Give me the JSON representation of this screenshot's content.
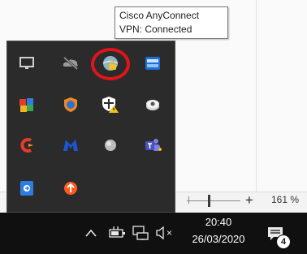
{
  "tooltip": {
    "line1": "Cisco AnyConnect",
    "line2": "VPN: Connected"
  },
  "statusbar": {
    "zoom_value": "161 %",
    "zoom_plus": "+"
  },
  "tray_icons": [
    {
      "name": "monitor-icon"
    },
    {
      "name": "onedrive-offline-icon"
    },
    {
      "name": "cisco-anyconnect-vpn-icon"
    },
    {
      "name": "keyboard-ime-icon"
    },
    {
      "name": "multicolor-app-icon"
    },
    {
      "name": "globe-shield-icon"
    },
    {
      "name": "security-warning-shield-icon"
    },
    {
      "name": "drive-sync-icon"
    },
    {
      "name": "ccleaner-icon"
    },
    {
      "name": "malwarebytes-icon"
    },
    {
      "name": "gray-ball-icon"
    },
    {
      "name": "teams-icon"
    },
    {
      "name": "remote-access-icon"
    },
    {
      "name": "orange-update-icon"
    }
  ],
  "taskbar": {
    "time": "20:40",
    "date": "26/03/2020",
    "notification_count": "4",
    "chevron_glyph": "^",
    "volume_mute_glyph": "×"
  },
  "colors": {
    "highlight_ring": "#e0141b",
    "taskbar": "#101010",
    "flyout": "#2b2b2b"
  }
}
